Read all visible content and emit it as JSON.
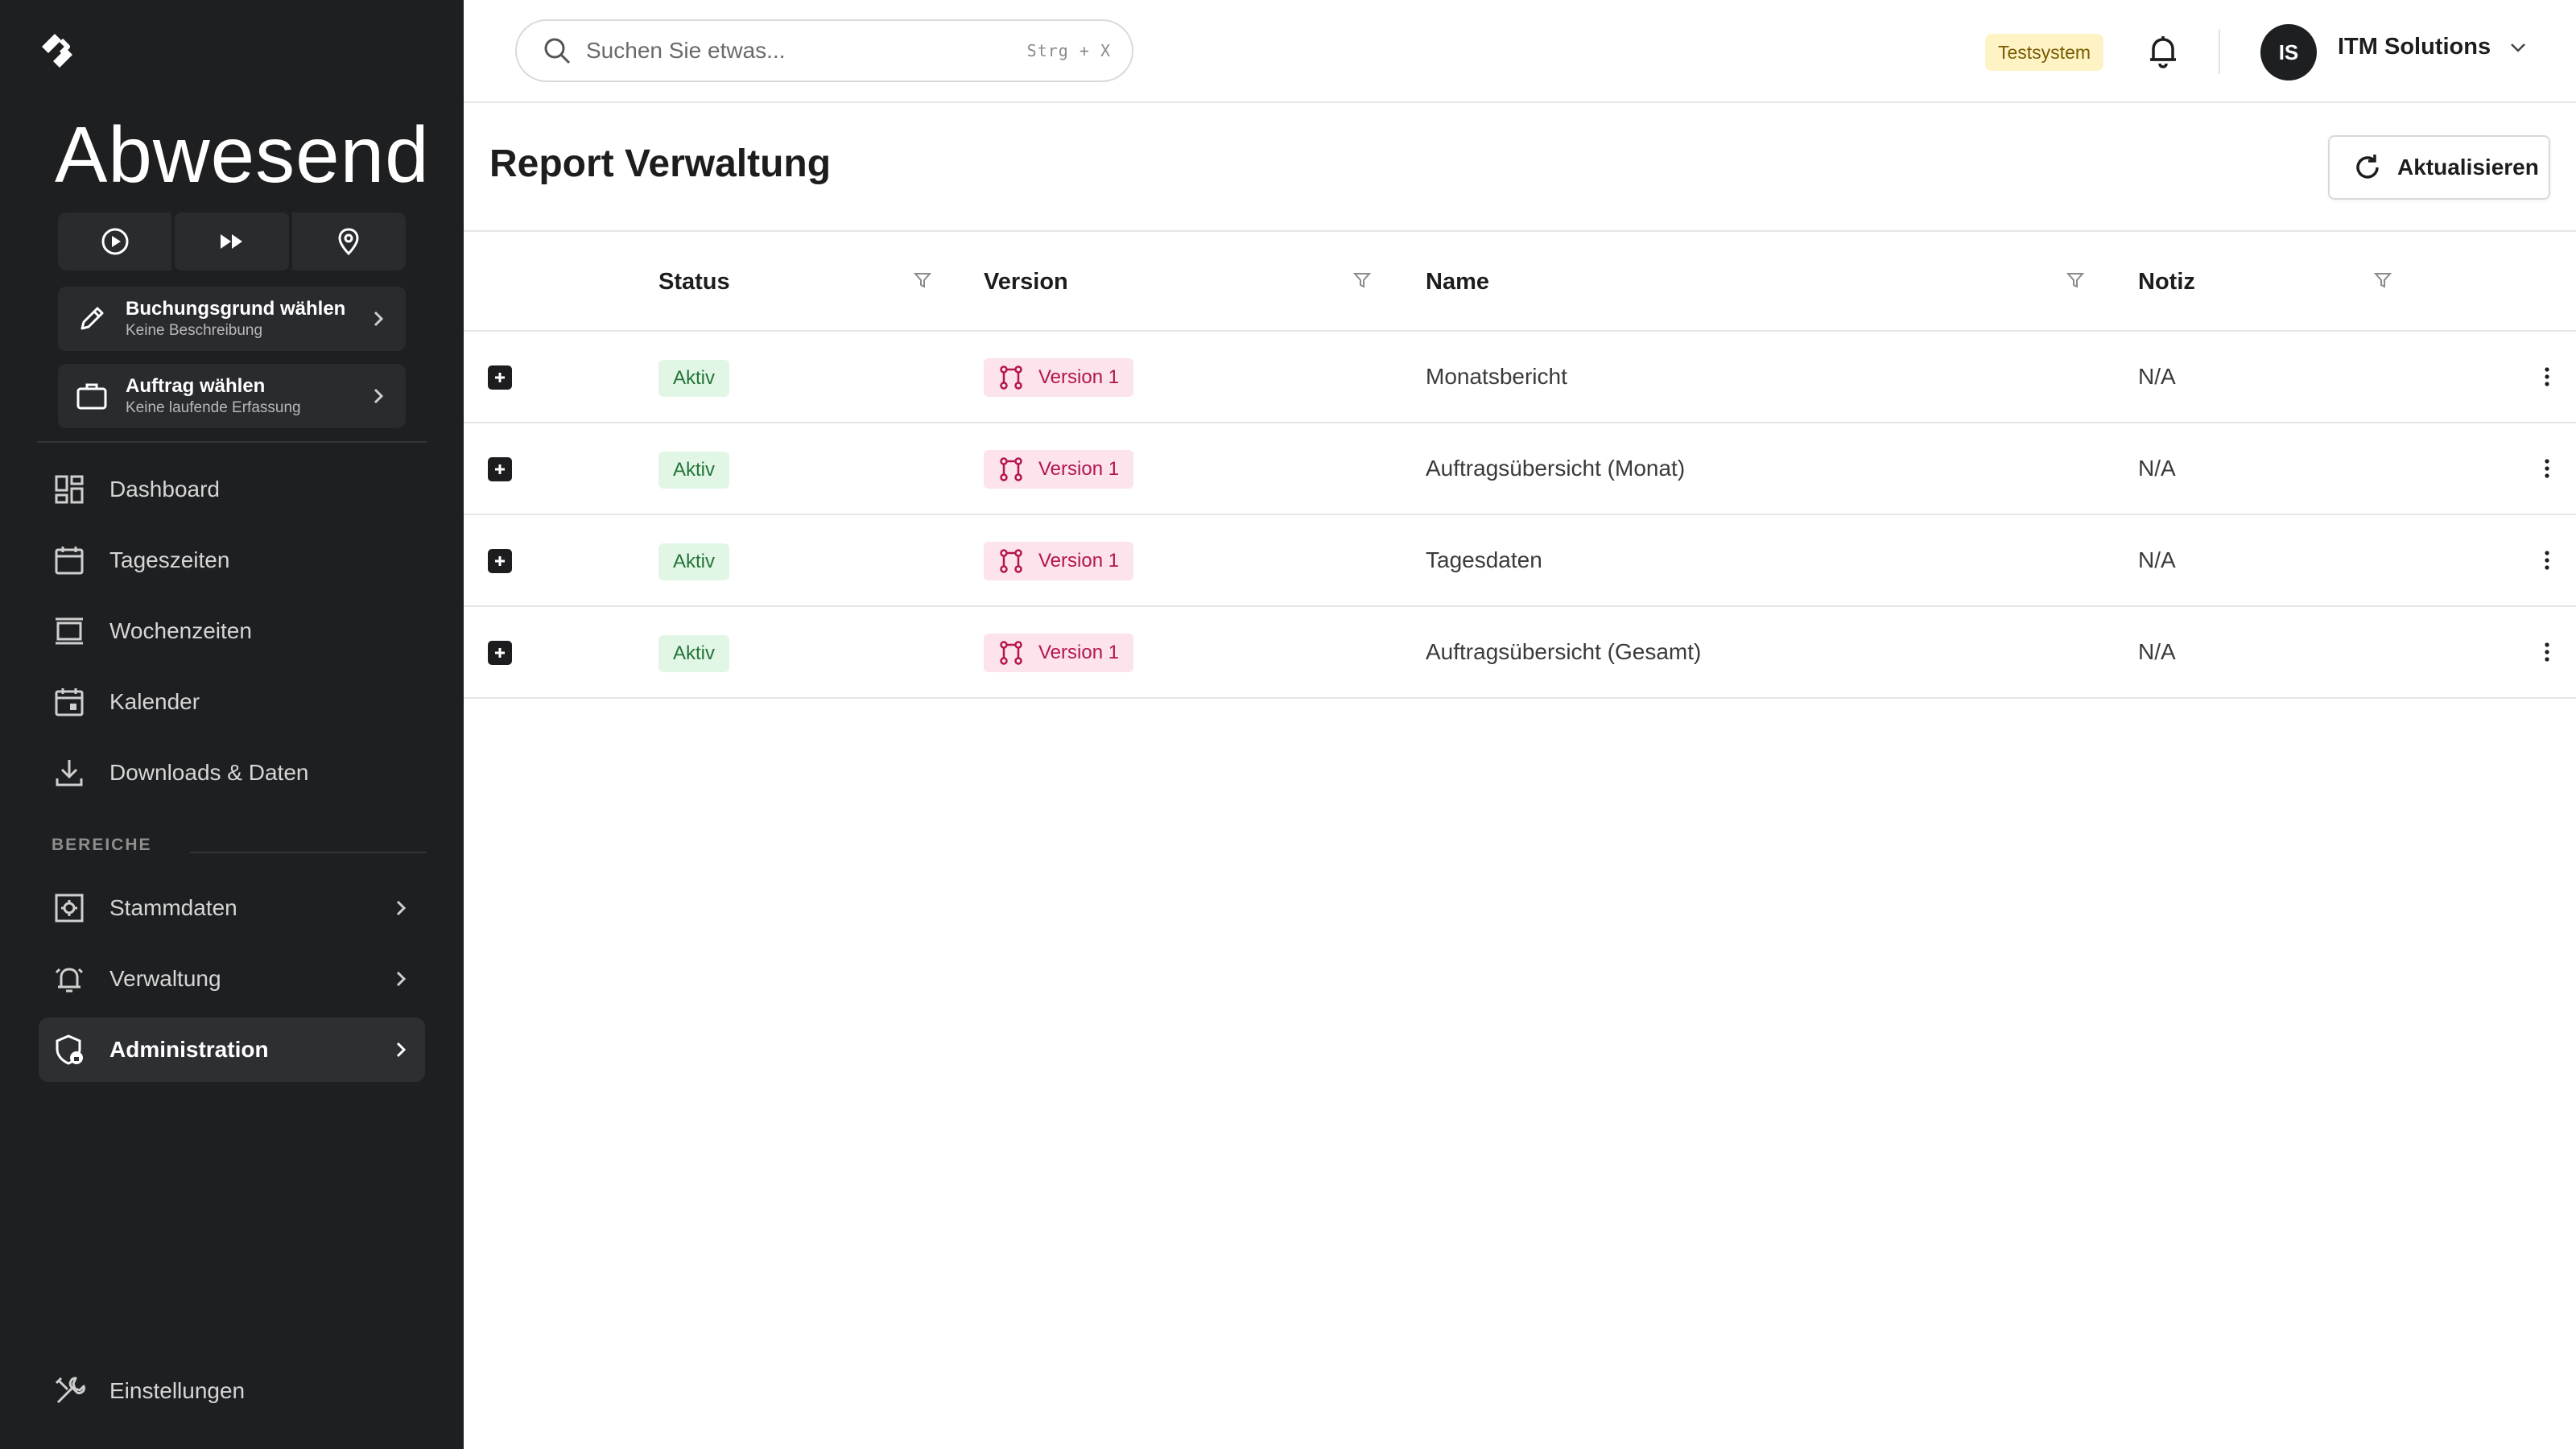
{
  "sidebar": {
    "status_title": "Abwesend",
    "controls": [
      {
        "icon": "play-circle-icon"
      },
      {
        "icon": "fast-forward-icon"
      },
      {
        "icon": "location-pin-icon"
      }
    ],
    "booking_card": {
      "title": "Buchungsgrund wählen",
      "subtitle": "Keine Beschreibung",
      "icon": "pencil-icon"
    },
    "order_card": {
      "title": "Auftrag wählen",
      "subtitle": "Keine laufende Erfassung",
      "icon": "briefcase-icon"
    },
    "nav": [
      {
        "label": "Dashboard",
        "icon": "dashboard-icon"
      },
      {
        "label": "Tageszeiten",
        "icon": "calendar-day-icon"
      },
      {
        "label": "Wochenzeiten",
        "icon": "week-view-icon"
      },
      {
        "label": "Kalender",
        "icon": "calendar-icon"
      },
      {
        "label": "Downloads & Daten",
        "icon": "download-icon"
      }
    ],
    "section_label": "BEREICHE",
    "sections": [
      {
        "label": "Stammdaten",
        "icon": "master-data-icon"
      },
      {
        "label": "Verwaltung",
        "icon": "bell-alert-icon"
      },
      {
        "label": "Administration",
        "icon": "shield-lock-icon",
        "active": true
      }
    ],
    "settings": {
      "label": "Einstellungen",
      "icon": "tools-icon"
    }
  },
  "header": {
    "search_placeholder": "Suchen Sie etwas...",
    "search_shortcut": "Strg + X",
    "env_badge": "Testsystem",
    "avatar_initials": "IS",
    "account_name": "ITM Solutions"
  },
  "page": {
    "title": "Report Verwaltung",
    "refresh_label": "Aktualisieren"
  },
  "table": {
    "columns": [
      "Status",
      "Version",
      "Name",
      "Notiz"
    ],
    "rows": [
      {
        "status": "Aktiv",
        "version": "Version 1",
        "name": "Monatsbericht",
        "note": "N/A"
      },
      {
        "status": "Aktiv",
        "version": "Version 1",
        "name": "Auftragsübersicht (Monat)",
        "note": "N/A"
      },
      {
        "status": "Aktiv",
        "version": "Version 1",
        "name": "Tagesdaten",
        "note": "N/A"
      },
      {
        "status": "Aktiv",
        "version": "Version 1",
        "name": "Auftragsübersicht (Gesamt)",
        "note": "N/A"
      }
    ]
  },
  "colors": {
    "sidebar_bg": "#1e1f21",
    "status_badge_bg": "#e2f6e6",
    "status_badge_text": "#23743a",
    "version_badge_bg": "#fce3ec",
    "version_badge_text": "#b4154e",
    "env_badge_bg": "#fdf3c4"
  }
}
